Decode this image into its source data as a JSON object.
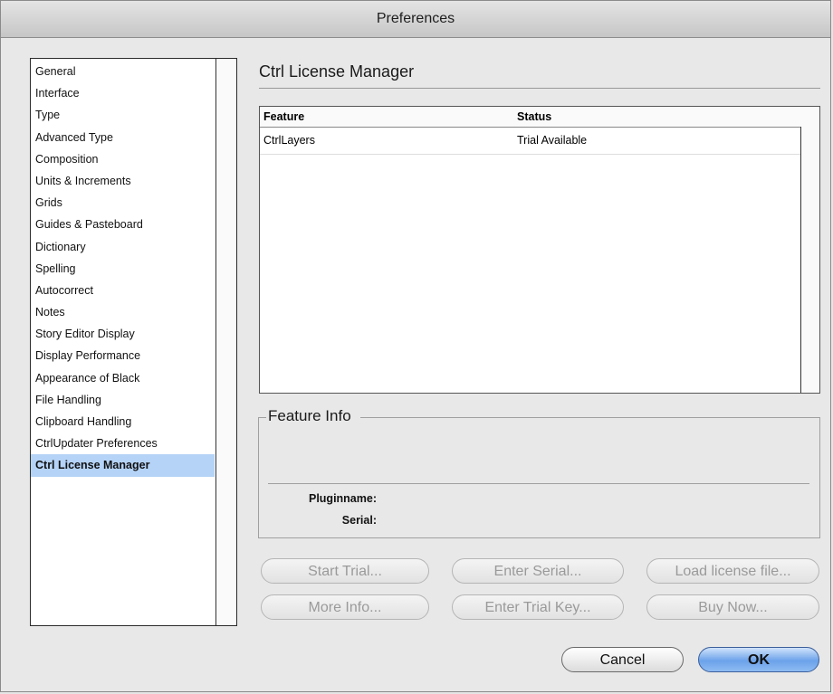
{
  "window": {
    "title": "Preferences"
  },
  "sidebar": {
    "items": [
      "General",
      "Interface",
      "Type",
      "Advanced Type",
      "Composition",
      "Units & Increments",
      "Grids",
      "Guides & Pasteboard",
      "Dictionary",
      "Spelling",
      "Autocorrect",
      "Notes",
      "Story Editor Display",
      "Display Performance",
      "Appearance of Black",
      "File Handling",
      "Clipboard Handling",
      "CtrlUpdater Preferences",
      "Ctrl License Manager"
    ],
    "selected": "Ctrl License Manager"
  },
  "panel": {
    "title": "Ctrl License Manager",
    "table": {
      "columns": [
        "Feature",
        "Status"
      ],
      "rows": [
        {
          "feature": "CtrlLayers",
          "status": "Trial Available"
        }
      ]
    },
    "feature_info": {
      "title": "Feature Info",
      "pluginname_label": "Pluginname:",
      "serial_label": "Serial:"
    },
    "buttons": {
      "start_trial": "Start Trial...",
      "enter_serial": "Enter Serial...",
      "load_license_file": "Load license file...",
      "more_info": "More Info...",
      "enter_trial_key": "Enter Trial Key...",
      "buy_now": "Buy Now..."
    }
  },
  "footer": {
    "cancel": "Cancel",
    "ok": "OK"
  },
  "colors": {
    "selection": "#b5d3f7",
    "default_button": "#6ba2ea"
  }
}
